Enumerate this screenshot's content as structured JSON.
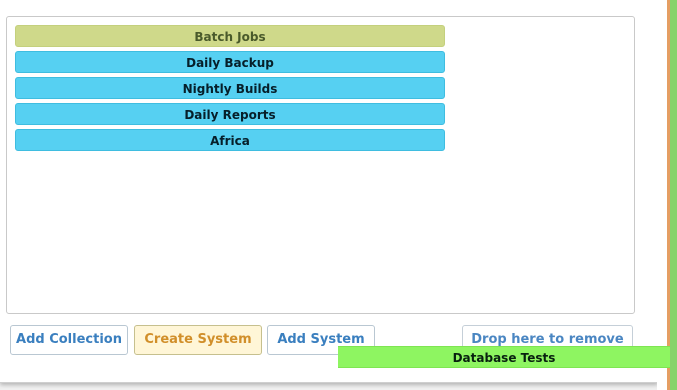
{
  "groups": [
    {
      "label": "Batch Jobs",
      "kind": "header"
    },
    {
      "label": "Daily Backup",
      "kind": "item"
    },
    {
      "label": "Nightly Builds",
      "kind": "item"
    },
    {
      "label": "Daily Reports",
      "kind": "item"
    },
    {
      "label": "Africa",
      "kind": "item"
    }
  ],
  "actions": {
    "add_collection": "Add Collection",
    "create_system": "Create System",
    "add_system": "Add System",
    "drop_remove": "Drop here to remove"
  },
  "dragging": {
    "label": "Database Tests"
  },
  "colors": {
    "header_bg": "#cfd98a",
    "item_bg": "#56d0f2",
    "create_bg": "#fff6d7",
    "drag_bg": "#8ef561",
    "orange_edge": "#e59e63",
    "green_edge": "#86d36b"
  }
}
